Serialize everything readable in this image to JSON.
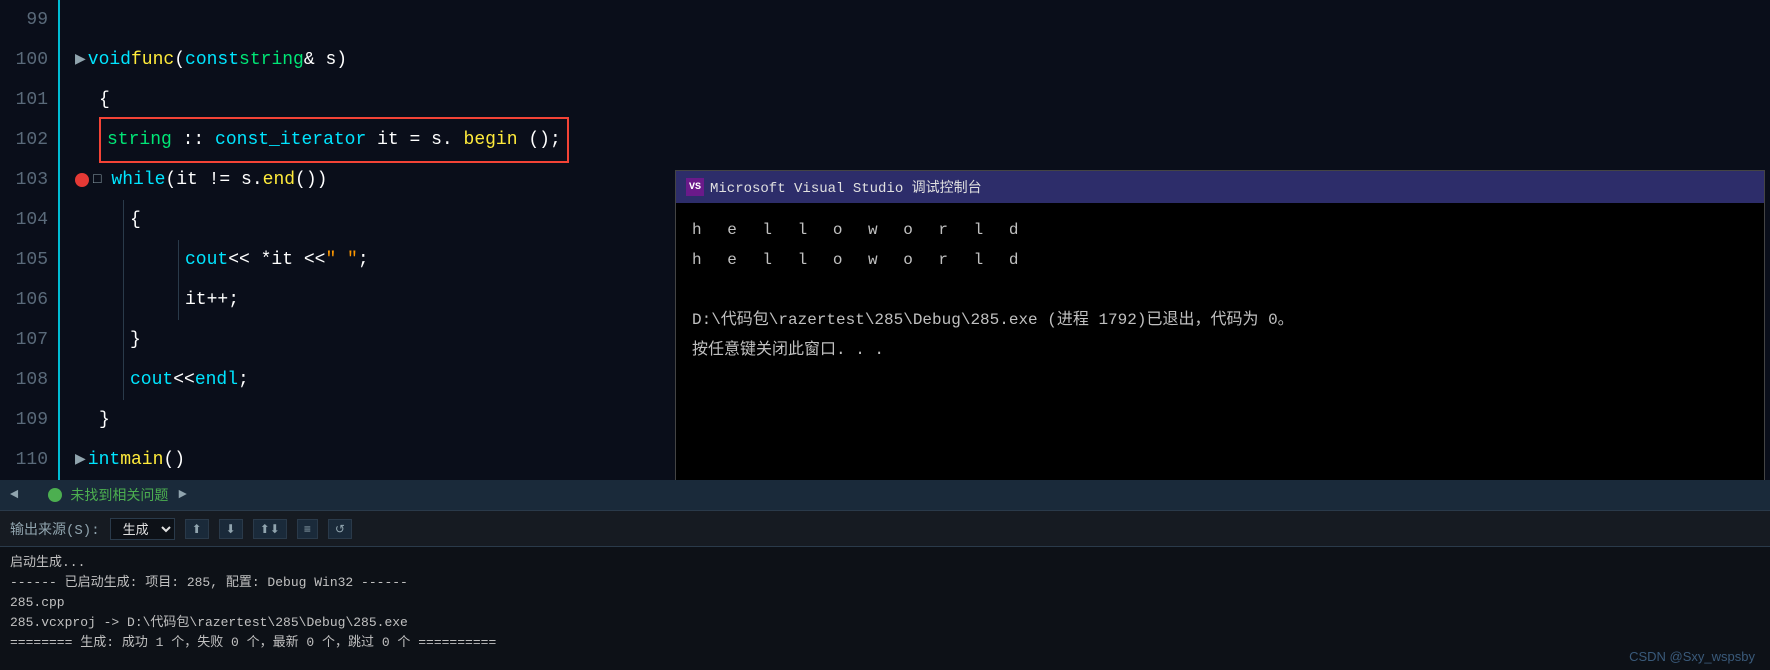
{
  "editor": {
    "lines": [
      {
        "num": "99",
        "indent": 0,
        "code": "",
        "parts": []
      },
      {
        "num": "100",
        "indent": 0,
        "code": "▶void func(const string& s)",
        "collapse": true
      },
      {
        "num": "101",
        "indent": 0,
        "code": "{"
      },
      {
        "num": "102",
        "indent": 1,
        "code": "string::const_iterator it = s.begin();",
        "highlight": true
      },
      {
        "num": "103",
        "indent": 0,
        "code": "while (it != s.end())",
        "breakpoint": true,
        "collapse": true
      },
      {
        "num": "104",
        "indent": 1,
        "code": "{"
      },
      {
        "num": "105",
        "indent": 2,
        "code": "cout << *it << \" \";"
      },
      {
        "num": "106",
        "indent": 2,
        "code": "it++;"
      },
      {
        "num": "107",
        "indent": 1,
        "code": "}"
      },
      {
        "num": "108",
        "indent": 1,
        "code": "cout << endl;"
      },
      {
        "num": "109",
        "indent": 0,
        "code": "}"
      },
      {
        "num": "110",
        "indent": 0,
        "code": "▶int main()",
        "collapse": true
      }
    ]
  },
  "status_bar": {
    "ok_text": "未找到相关问题",
    "scroll_indicator": "◄  ►"
  },
  "output_panel": {
    "label": "输出来源(S):",
    "source": "生成",
    "lines": [
      "启动生成...",
      "------ 已启动生成: 项目: 285, 配置: Debug Win32 ------",
      "285.cpp",
      "285.vcxproj -> D:\\代码包\\razertest\\285\\Debug\\285.exe",
      "======== 生成: 成功 1 个，失败 0 个，最新 0 个，跳过 0 个 =========="
    ]
  },
  "debug_console": {
    "title": "Microsoft Visual Studio 调试控制台",
    "vs_icon": "VS",
    "output_lines": [
      "h e l l o   w o r l d",
      "h e l l o   w o r l d",
      "",
      "D:\\代码包\\razertest\\285\\Debug\\285.exe (进程 1792)已退出，代码为 0。",
      "按任意键关闭此窗口. . ."
    ]
  },
  "watermark": {
    "text": "CSDN @Sxy_wspsby"
  },
  "toolbar_buttons": [
    "⬆",
    "⬇",
    "⬆⬇",
    "≡≡",
    "↺"
  ],
  "colors": {
    "accent_cyan": "#00e5ff",
    "breakpoint_red": "#e53935",
    "highlight_border": "#f44336",
    "bg_dark": "#0a0e1a",
    "console_bg": "#000000"
  }
}
